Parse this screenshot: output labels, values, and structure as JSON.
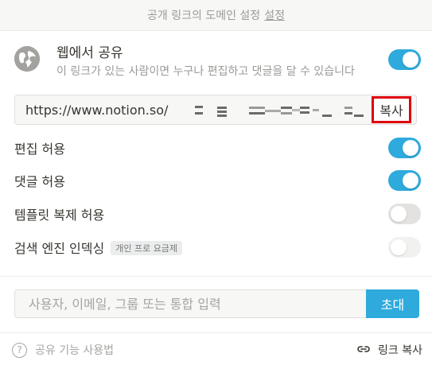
{
  "banner": {
    "text": "공개 링크의 도메인 설정",
    "link": "설정"
  },
  "share_web": {
    "icon": "globe-icon",
    "title": "웹에서 공유",
    "description": "이 링크가 있는 사람이면 누구나 편집하고 댓글을 달 수 있습니다",
    "enabled": true
  },
  "url_box": {
    "url": "https://www.notion.so/",
    "copy_label": "복사"
  },
  "options": [
    {
      "label": "편집 허용",
      "enabled": true,
      "state": "on"
    },
    {
      "label": "댓글 허용",
      "enabled": true,
      "state": "on"
    },
    {
      "label": "템플릿 복제 허용",
      "enabled": false,
      "state": "off"
    },
    {
      "label": "검색 엔진 인덱싱",
      "badge": "개인 프로 요금제",
      "enabled": false,
      "state": "disabled"
    }
  ],
  "invite": {
    "placeholder": "사용자, 이메일, 그룹 또는 통합 입력",
    "button": "초대"
  },
  "footer": {
    "help_icon": "question-circle-icon",
    "help": "공유 기능 사용법",
    "copy_icon": "link-icon",
    "copy_link": "링크 복사"
  },
  "colors": {
    "accent": "#2eaadc",
    "highlight_border": "#e0000e",
    "muted_text": "#9b9a97"
  }
}
